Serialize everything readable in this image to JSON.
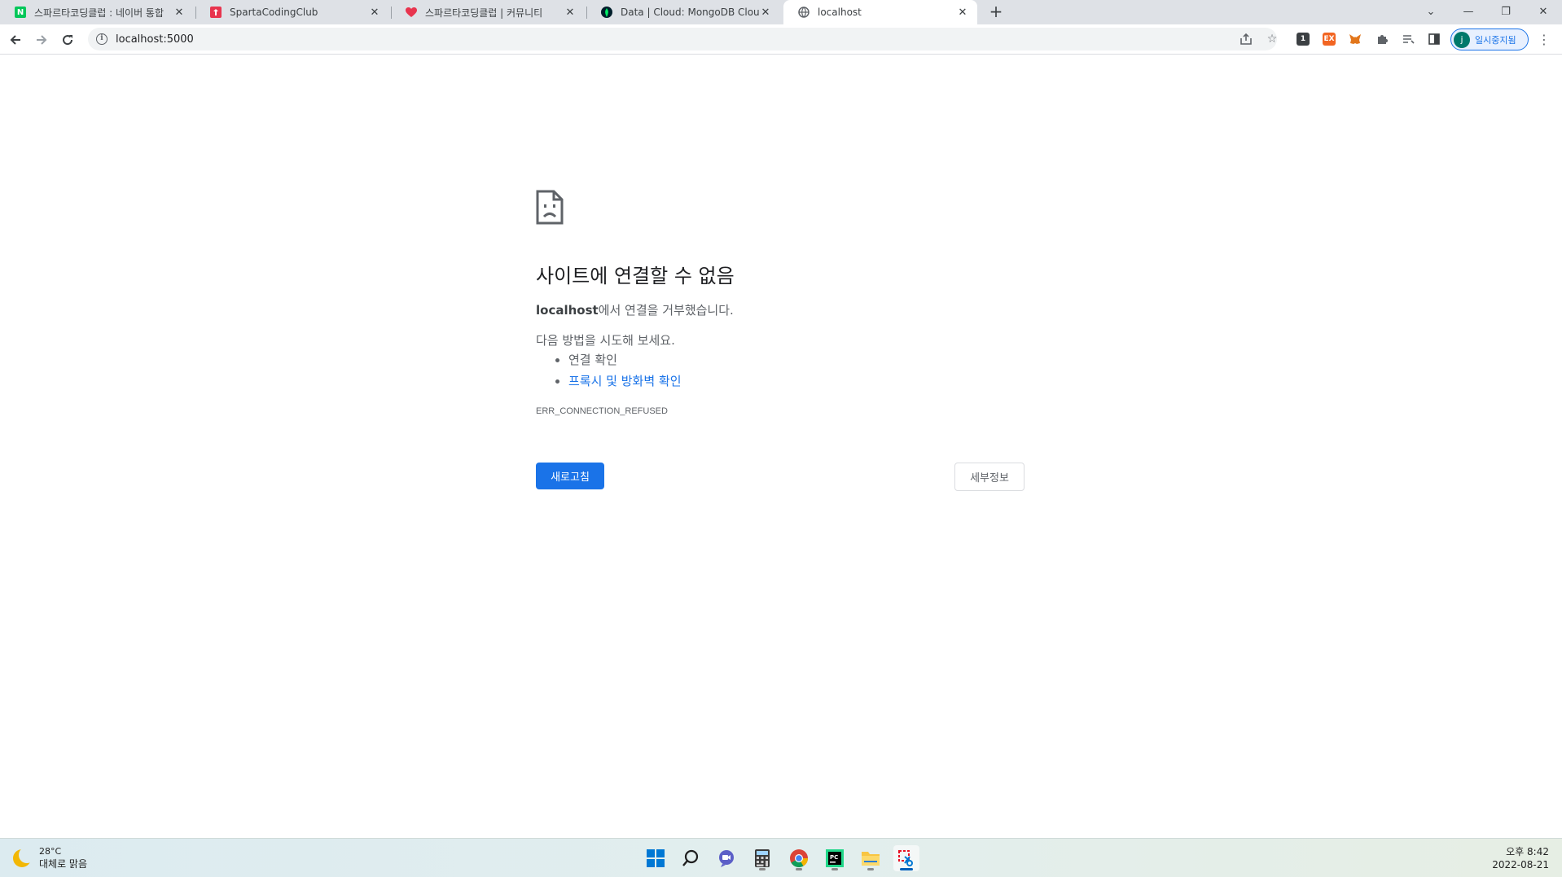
{
  "browser": {
    "tabs": [
      {
        "title": "스파르타코딩클럽 : 네이버 통합",
        "favicon": "naver-n-icon",
        "fav_color": "#03c75a",
        "fav_text": "N"
      },
      {
        "title": "SpartaCodingClub",
        "favicon": "sparta-icon",
        "fav_color": "#e8344e",
        "fav_text": ""
      },
      {
        "title": "스파르타코딩클럽 | 커뮤니티",
        "favicon": "heart-icon",
        "fav_color": "#e8344e",
        "fav_text": ""
      },
      {
        "title": "Data | Cloud: MongoDB Cloud",
        "favicon": "mongodb-leaf-icon",
        "fav_color": "#001e2b",
        "fav_text": ""
      },
      {
        "title": "localhost",
        "favicon": "globe-icon",
        "fav_color": "#5f6368",
        "fav_text": ""
      }
    ],
    "new_tab_glyph": "+",
    "address": "localhost:5000",
    "profile": {
      "initial": "j",
      "label": "일시중지됨"
    },
    "extensions": [
      {
        "name": "extension-1-icon",
        "text": "1",
        "color": "#3c4043"
      },
      {
        "name": "extension-ex-icon",
        "text": "EX",
        "color": "#f26522"
      },
      {
        "name": "metamask-icon",
        "text": "",
        "color": "#e2761b"
      }
    ]
  },
  "error_page": {
    "title": "사이트에 연결할 수 없음",
    "host": "localhost",
    "message_suffix": "에서 연결을 거부했습니다.",
    "try_label": "다음 방법을 시도해 보세요.",
    "suggestions": [
      "연결 확인",
      "프록시 및 방화벽 확인"
    ],
    "error_code": "ERR_CONNECTION_REFUSED",
    "reload_button": "새로고침",
    "details_button": "세부정보"
  },
  "taskbar": {
    "weather": {
      "temp": "28°C",
      "condition": "대체로 맑음"
    },
    "time": "오후 8:42",
    "date": "2022-08-21"
  },
  "colors": {
    "accent": "#1a73e8",
    "tabstrip": "#dee1e6"
  }
}
